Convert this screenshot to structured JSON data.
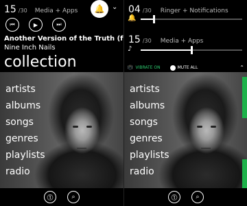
{
  "left": {
    "volume": {
      "value": "15",
      "max": "/30",
      "label": "Media + Apps"
    },
    "song_title": "Another Version of the Truth (feat. H",
    "artist": "Nine Inch Nails",
    "heading": "collection",
    "menu": [
      "artists",
      "albums",
      "songs",
      "genres",
      "playlists",
      "radio"
    ],
    "controls": {
      "prev": "⏮",
      "play": "▶",
      "next": "⏭"
    },
    "appbar": {
      "app1": "⓵",
      "search": "🔍"
    }
  },
  "right": {
    "ringer": {
      "value": "04",
      "max": "/30",
      "label": "Ringer + Notifications",
      "level": 0.13
    },
    "media": {
      "value": "15",
      "max": "/30",
      "label": "Media + Apps",
      "level": 0.5
    },
    "vibrate_label": "VIBRATE ON",
    "mute_label": "MUTE ALL",
    "menu": [
      "artists",
      "albums",
      "songs",
      "genres",
      "playlists",
      "radio"
    ]
  },
  "colors": {
    "accent": "#1db24a"
  }
}
